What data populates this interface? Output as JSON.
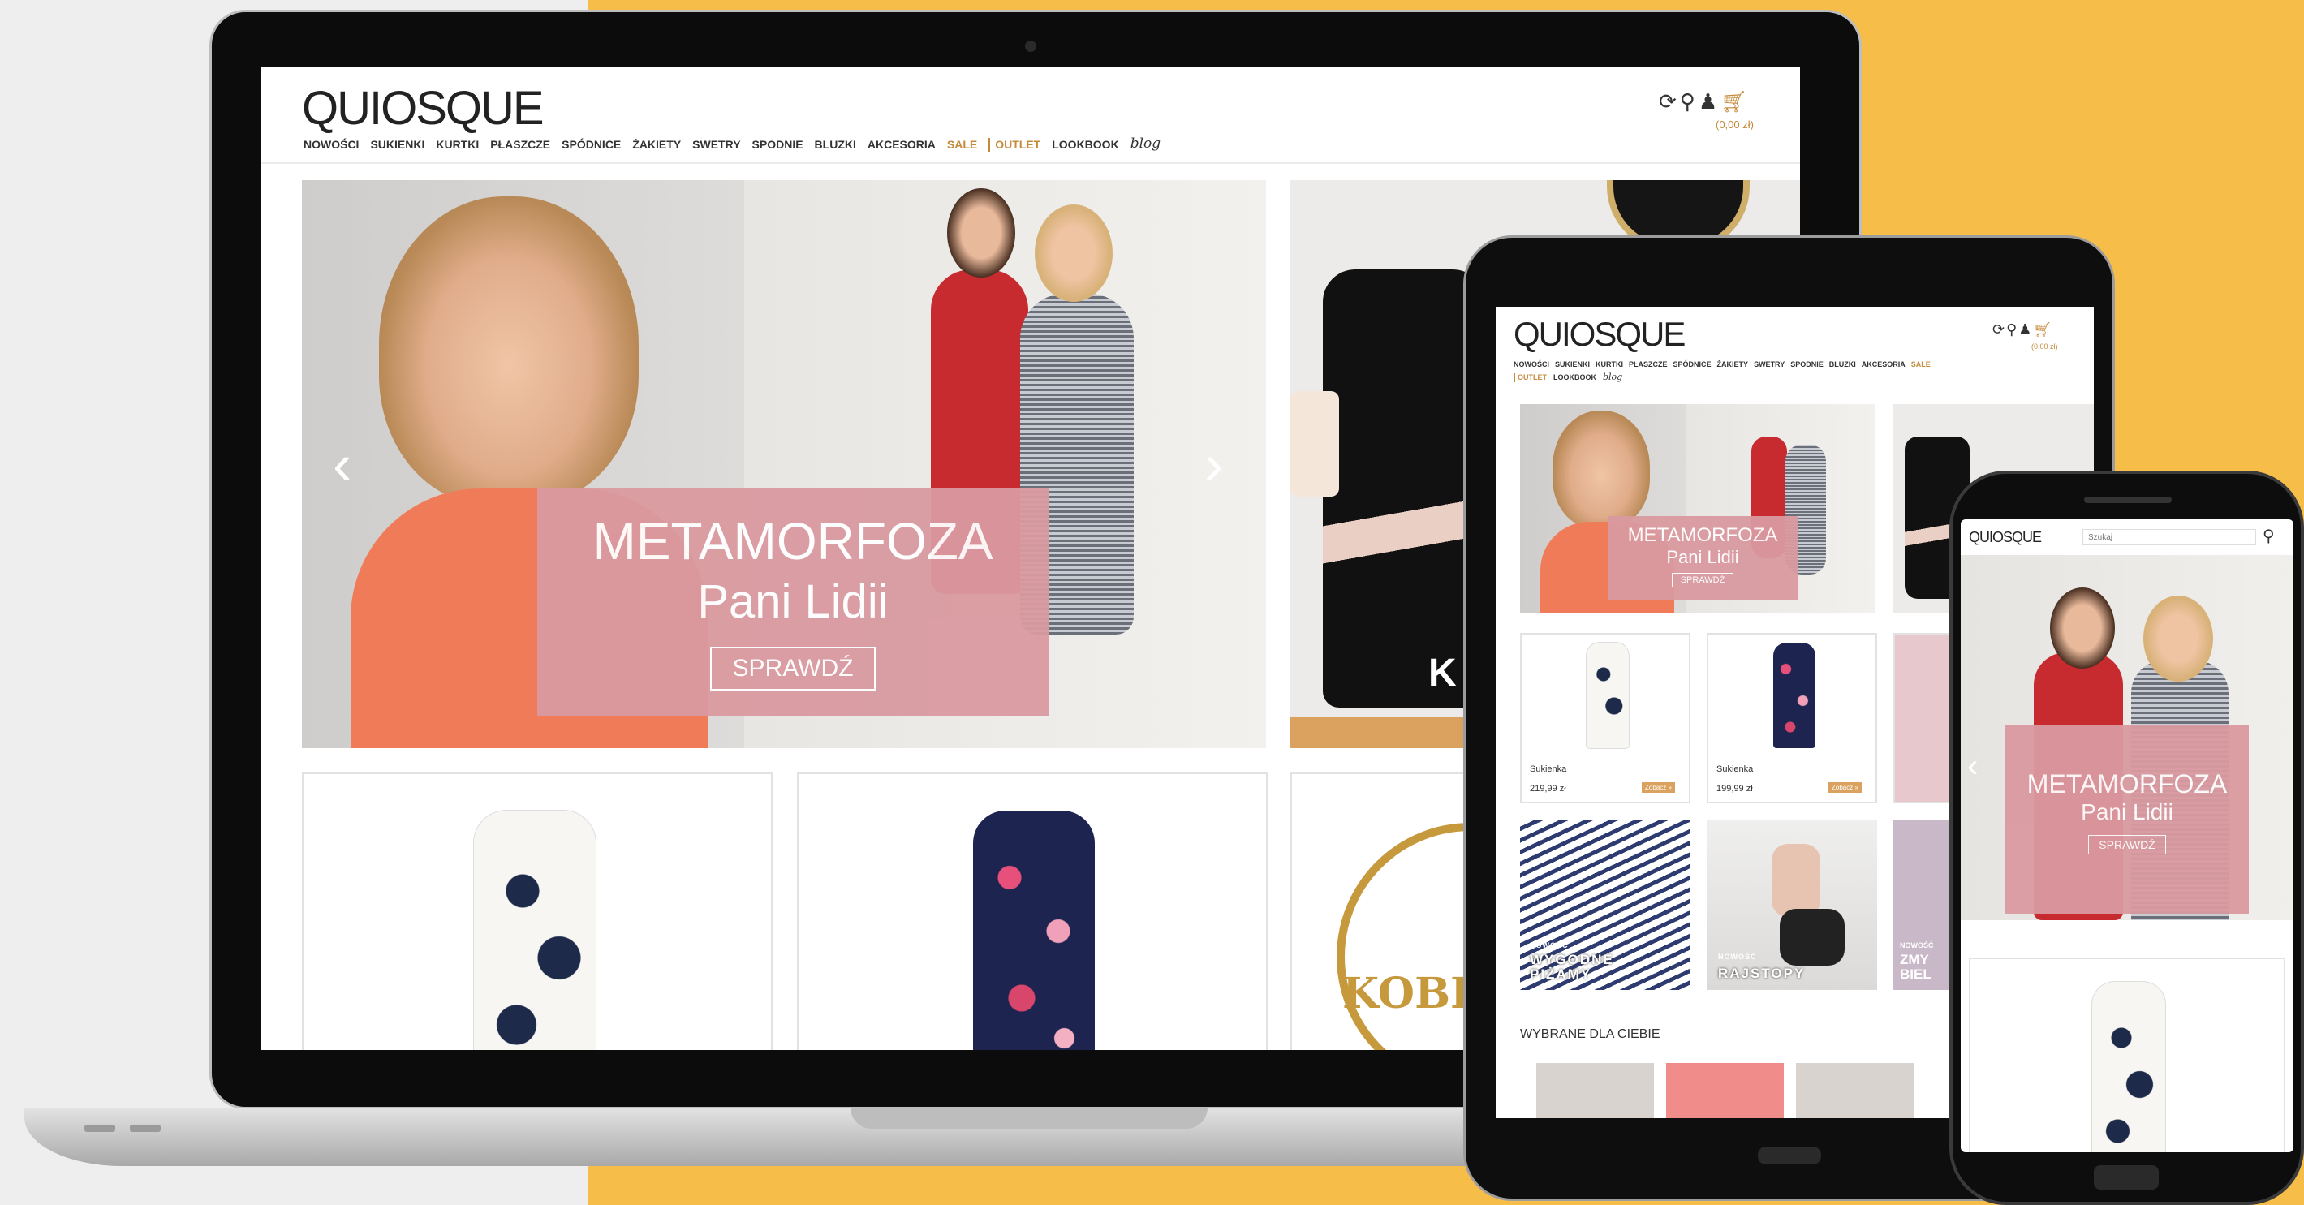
{
  "colors": {
    "accent": "#c58a3a",
    "promo": "#d99aa0",
    "background_yellow": "#f6be48"
  },
  "laptop": {
    "logo": "QUIOSQUE",
    "nav": [
      "NOWOŚCI",
      "SUKIENKI",
      "KURTKI",
      "PŁASZCZE",
      "SPÓDNICE",
      "ŻAKIETY",
      "SWETRY",
      "SPODNIE",
      "BLUZKI",
      "AKCESORIA"
    ],
    "nav_sale": "SALE",
    "nav_outlet": "OUTLET",
    "nav_lookbook": "LOOKBOOK",
    "nav_blog": "blog",
    "cart_total": "(0,00 zł)",
    "icons": [
      "refresh-icon",
      "search-icon",
      "user-icon",
      "cart-icon"
    ],
    "hero": {
      "title": "METAMORFOZA",
      "subtitle": "Pani Lidii",
      "button": "SPRAWDŹ",
      "prev": "‹",
      "next": "›"
    },
    "side_banner_letter": "K",
    "badge_text": "KOBIE"
  },
  "tablet": {
    "logo": "QUIOSQUE",
    "nav_row1": [
      "NOWOŚCI",
      "SUKIENKI",
      "KURTKI",
      "PŁASZCZE",
      "SPÓDNICE",
      "ŻAKIETY",
      "SWETRY",
      "SPODNIE",
      "BLUZKI",
      "AKCESORIA"
    ],
    "nav_sale": "SALE",
    "nav_outlet": "OUTLET",
    "nav_lookbook": "LOOKBOOK",
    "nav_blog": "blog",
    "cart_total": "(0,00 zł)",
    "hero": {
      "title": "METAMORFOZA",
      "subtitle": "Pani Lidii",
      "button": "SPRAWDŹ"
    },
    "products": [
      {
        "name": "Sukienka",
        "price": "219,99 zł",
        "button": "Zobacz »"
      },
      {
        "name": "Sukienka",
        "price": "199,99 zł",
        "button": "Zobacz »"
      }
    ],
    "tiles": [
      {
        "tag": "NOWOŚĆ",
        "title": "WYGODNE PIŻAMY"
      },
      {
        "tag": "NOWOŚĆ",
        "title": "RAJSTOPY"
      },
      {
        "tag": "NOWOŚĆ",
        "title": "ZMY BIEL"
      }
    ],
    "section_title": "WYBRANE DLA CIEBIE"
  },
  "phone": {
    "logo": "QUIOSQUE",
    "search_placeholder": "Szukaj",
    "hero": {
      "title": "METAMORFOZA",
      "subtitle": "Pani Lidii",
      "button": "SPRAWDŹ"
    }
  }
}
